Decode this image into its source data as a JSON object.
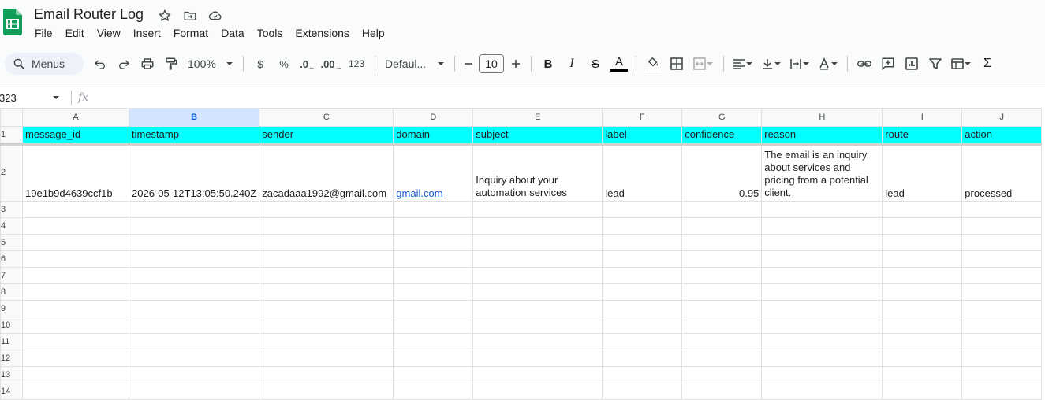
{
  "app": {
    "title": "Email Router Log",
    "accent_color": "#0f9d58"
  },
  "menubar": [
    "File",
    "Edit",
    "View",
    "Insert",
    "Format",
    "Data",
    "Tools",
    "Extensions",
    "Help"
  ],
  "toolbar": {
    "menus_label": "Menus",
    "zoom": "100%",
    "currency": "$",
    "percent": "%",
    "dec_decrease": ".0",
    "dec_increase": ".00",
    "number_format": "123",
    "font": "Defaul...",
    "font_size": "10",
    "text_color_glyph": "A",
    "bold": "B",
    "italic": "I",
    "strike": "S"
  },
  "formula_bar": {
    "cell_ref": "323",
    "fx": "fx",
    "value": ""
  },
  "sheet": {
    "columns": [
      "A",
      "B",
      "C",
      "D",
      "E",
      "F",
      "G",
      "H",
      "I",
      "J"
    ],
    "selected_column": "B",
    "header_fill": "#00ffff",
    "rows": [
      {
        "num": "1",
        "cells": [
          "message_id",
          "timestamp",
          "sender",
          "domain",
          "subject",
          "label",
          "confidence",
          "reason",
          "route",
          "action"
        ]
      },
      {
        "num": "2",
        "cells": [
          "19e1b9d4639ccf1b",
          "2026-05-12T13:05:50.240Z",
          "zacadaaa1992@gmail.com",
          "gmail.com",
          "Inquiry about your automation services",
          "lead",
          "0.95",
          "The email is an inquiry about services and pricing from a potential client.",
          "lead",
          "processed"
        ]
      }
    ],
    "empty_rows": [
      "3",
      "4",
      "5",
      "6",
      "7",
      "8",
      "9",
      "10",
      "11",
      "12",
      "13",
      "14"
    ]
  }
}
